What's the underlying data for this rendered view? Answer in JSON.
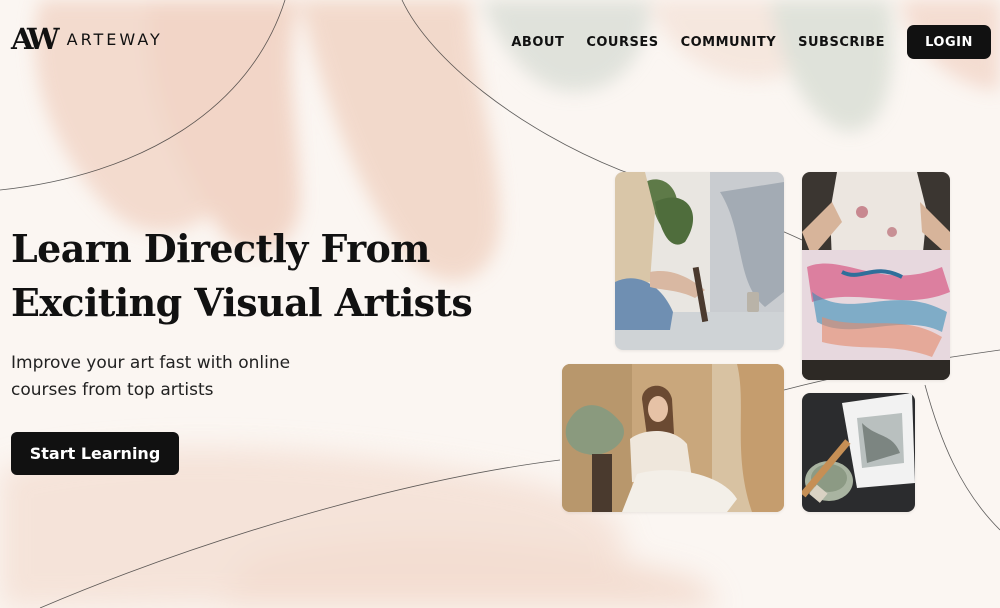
{
  "brand": {
    "mark": "AW",
    "name": "ARTEWAY"
  },
  "nav": {
    "items": [
      "ABOUT",
      "COURSES",
      "COMMUNITY",
      "SUBSCRIBE"
    ],
    "login": "LOGIN"
  },
  "hero": {
    "title_lines": [
      "Learn Directly From",
      "Exciting Visual Artists"
    ],
    "subtitle_lines": [
      "Improve your art fast with online",
      "courses from top artists"
    ],
    "cta": "Start Learning"
  },
  "colors": {
    "background": "#fbf6f2",
    "ink": "#111111",
    "brushstroke_peach": "#efcdbd",
    "brushstroke_sage": "#cfd6cc"
  }
}
